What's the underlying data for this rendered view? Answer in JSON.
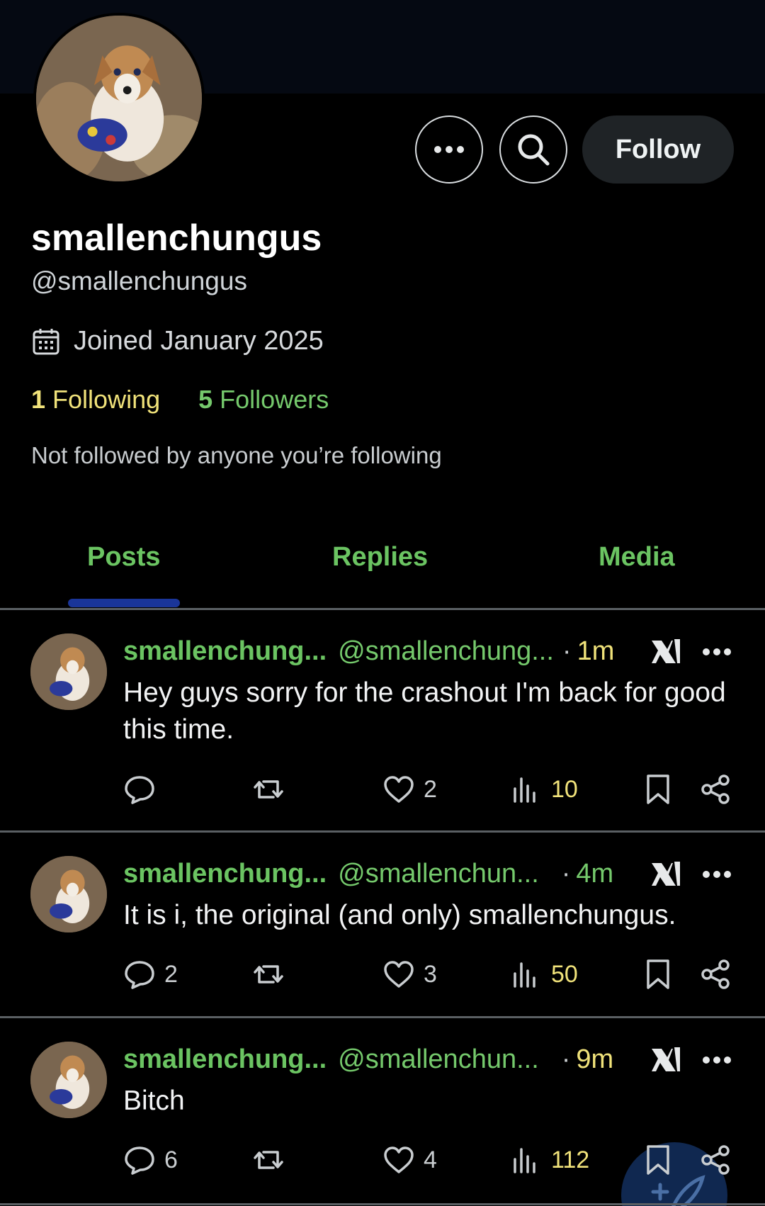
{
  "profile": {
    "display_name": "smallenchungus",
    "handle": "@smallenchungus",
    "joined": "Joined January 2025",
    "following_count": "1",
    "following_label": "Following",
    "followers_count": "5",
    "followers_label": "Followers",
    "not_followed_note": "Not followed by anyone you’re following"
  },
  "header_buttons": {
    "more_icon": "more-dots-icon",
    "search_icon": "search-icon",
    "follow_label": "Follow"
  },
  "tabs": [
    {
      "label": "Posts",
      "active": true
    },
    {
      "label": "Replies",
      "active": false
    },
    {
      "label": "Media",
      "active": false
    }
  ],
  "colors": {
    "accent_green": "#6bc462",
    "accent_yellow": "#f0e27a",
    "tab_underline": "#1a3599",
    "background": "#000000"
  },
  "posts": [
    {
      "name": "smallenchung...",
      "handle": "@smallenchung...",
      "dot": "·",
      "time": "1m",
      "time_color": "#f0e27a",
      "text": "Hey guys sorry for the crashout I'm back for good this time.",
      "replies": "",
      "reposts": "",
      "likes": "2",
      "views": "10"
    },
    {
      "name": "smallenchung...",
      "handle": "@smallenchun...",
      "dot": "·",
      "time": "4m",
      "time_color": "#75c96c",
      "text": "It is i, the original (and only) smallenchungus.",
      "replies": "2",
      "reposts": "",
      "likes": "3",
      "views": "50"
    },
    {
      "name": "smallenchung...",
      "handle": "@smallenchun...",
      "dot": "·",
      "time": "9m",
      "time_color": "#f0e27a",
      "text": "Bitch",
      "replies": "6",
      "reposts": "",
      "likes": "4",
      "views": "112"
    }
  ]
}
